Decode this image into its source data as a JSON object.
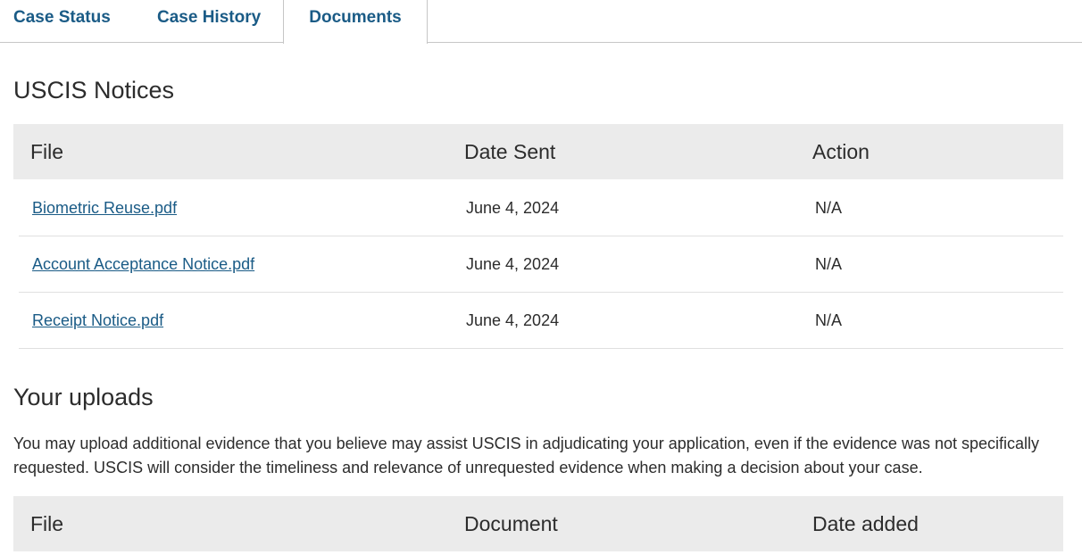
{
  "tabs": [
    {
      "label": "Case Status",
      "active": false
    },
    {
      "label": "Case History",
      "active": false
    },
    {
      "label": "Documents",
      "active": true
    }
  ],
  "notices": {
    "title": "USCIS Notices",
    "columns": [
      "File",
      "Date Sent",
      "Action"
    ],
    "rows": [
      {
        "file": "Biometric Reuse.pdf",
        "date": "June 4, 2024",
        "action": "N/A"
      },
      {
        "file": "Account Acceptance Notice.pdf",
        "date": "June 4, 2024",
        "action": "N/A"
      },
      {
        "file": "Receipt Notice.pdf",
        "date": "June 4, 2024",
        "action": "N/A"
      }
    ]
  },
  "uploads": {
    "title": "Your uploads",
    "description": "You may upload additional evidence that you believe may assist USCIS in adjudicating your application, even if the evidence was not specifically requested. USCIS will consider the timeliness and relevance of unrequested evidence when making a decision about your case.",
    "columns": [
      "File",
      "Document",
      "Date added"
    ]
  },
  "colors": {
    "link": "#1a5b86",
    "header_bg": "#ebebeb",
    "text": "#2c2c2c"
  }
}
